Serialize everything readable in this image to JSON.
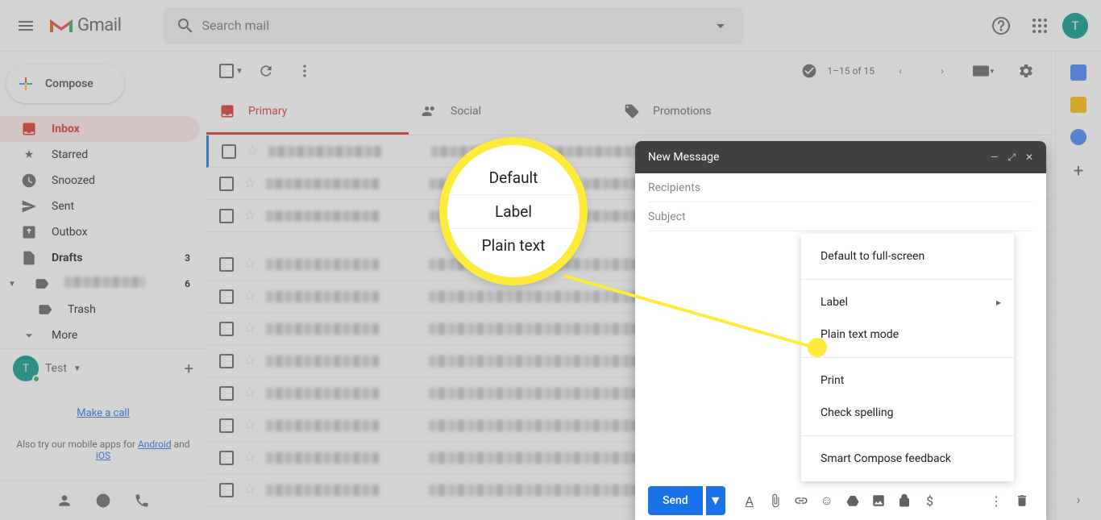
{
  "header": {
    "product": "Gmail",
    "search_placeholder": "Search mail",
    "avatar_letter": "T"
  },
  "sidebar": {
    "compose": "Compose",
    "items": [
      {
        "label": "Inbox",
        "icon": "inbox",
        "active": true
      },
      {
        "label": "Starred",
        "icon": "star"
      },
      {
        "label": "Snoozed",
        "icon": "clock"
      },
      {
        "label": "Sent",
        "icon": "send"
      },
      {
        "label": "Outbox",
        "icon": "outbox"
      },
      {
        "label": "Drafts",
        "icon": "file",
        "count": "3",
        "bold": true
      }
    ],
    "label_count": "6",
    "trash": "Trash",
    "more": "More",
    "user_name": "Test",
    "make_call": "Make a call",
    "promo_text": "Also try our mobile apps for ",
    "promo_android": "Android",
    "promo_and": " and ",
    "promo_ios": "iOS"
  },
  "toolbar": {
    "page_info": "1–15 of 15"
  },
  "tabs": {
    "primary": "Primary",
    "social": "Social",
    "promotions": "Promotions"
  },
  "compose_window": {
    "title": "New Message",
    "recipients": "Recipients",
    "subject": "Subject",
    "send": "Send"
  },
  "context_menu": {
    "item1": "Default to full-screen",
    "item2": "Label",
    "item3": "Plain text mode",
    "item4": "Print",
    "item5": "Check spelling",
    "item6": "Smart Compose feedback"
  },
  "callout": {
    "line1": "Default",
    "line2": "Label",
    "line3": "Plain text"
  }
}
